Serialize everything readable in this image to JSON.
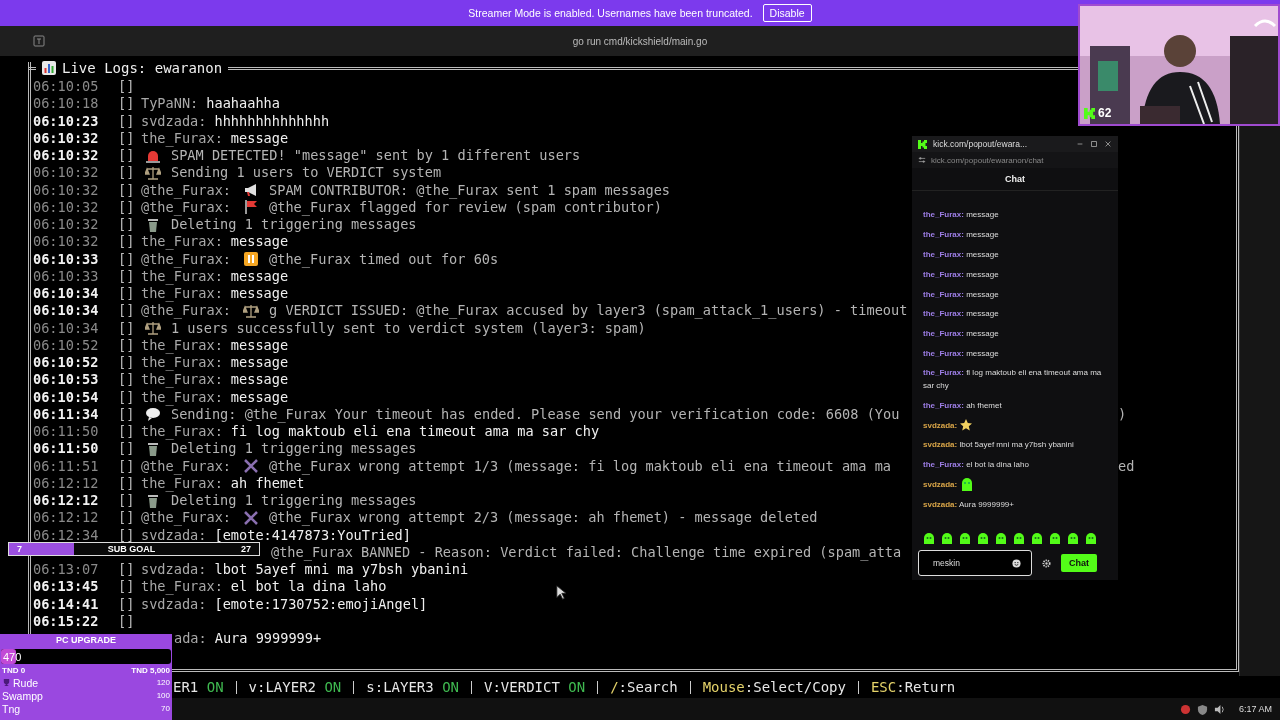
{
  "banner": {
    "text": "Streamer Mode is enabled. Usernames have been truncated.",
    "button": "Disable"
  },
  "terminal": {
    "title": "go run cmd/kickshield/main.go"
  },
  "panel": {
    "title": "Live Logs: ewaranon"
  },
  "logs": [
    {
      "time": "06:10:05",
      "bright": false,
      "tag": "[]",
      "kind": "empty"
    },
    {
      "time": "06:10:18",
      "bright": false,
      "tag": "[]",
      "kind": "chat",
      "user": "TyPaNN:",
      "msg": "haahaahha"
    },
    {
      "time": "06:10:23",
      "bright": true,
      "tag": "[]",
      "kind": "chat",
      "user": "svdzada:",
      "msg": "hhhhhhhhhhhhhh"
    },
    {
      "time": "06:10:32",
      "bright": true,
      "tag": "[]",
      "kind": "chat",
      "user": "the_Furax:",
      "msg": "message"
    },
    {
      "time": "06:10:32",
      "bright": true,
      "tag": "[]",
      "kind": "siren",
      "msg": "SPAM DETECTED! \"message\" sent by 1 different users"
    },
    {
      "time": "06:10:32",
      "bright": false,
      "tag": "[]",
      "kind": "scales",
      "msg": "Sending 1 users to VERDICT system"
    },
    {
      "time": "06:10:32",
      "bright": false,
      "tag": "[]",
      "kind": "megaphone",
      "user": "@the_Furax:",
      "msg": "SPAM CONTRIBUTOR: @the_Furax sent 1 spam messages"
    },
    {
      "time": "06:10:32",
      "bright": false,
      "tag": "[]",
      "kind": "flag",
      "user": "@the_Furax:",
      "msg": "@the_Furax flagged for review (spam contributor)"
    },
    {
      "time": "06:10:32",
      "bright": false,
      "tag": "[]",
      "kind": "trash",
      "msg": "Deleting 1 triggering messages"
    },
    {
      "time": "06:10:32",
      "bright": false,
      "tag": "[]",
      "kind": "chat",
      "user": "the_Furax:",
      "msg": "message"
    },
    {
      "time": "06:10:33",
      "bright": true,
      "tag": "[]",
      "kind": "pause",
      "user": "@the_Furax:",
      "msg": "@the_Furax timed out for 60s"
    },
    {
      "time": "06:10:33",
      "bright": false,
      "tag": "[]",
      "kind": "chat",
      "user": "the_Furax:",
      "msg": "message"
    },
    {
      "time": "06:10:34",
      "bright": true,
      "tag": "[]",
      "kind": "chat",
      "user": "the_Furax:",
      "msg": "message"
    },
    {
      "time": "06:10:34",
      "bright": true,
      "tag": "[]",
      "kind": "scales",
      "user": "@the_Furax:",
      "msg": "g VERDICT ISSUED: @the_Furax accused by layer3 (spam_attack_1_users) - timeout"
    },
    {
      "time": "06:10:34",
      "bright": false,
      "tag": "[]",
      "kind": "scales",
      "msg": "1 users successfully sent to verdict system (layer3: spam)"
    },
    {
      "time": "06:10:52",
      "bright": false,
      "tag": "[]",
      "kind": "chat",
      "user": "the_Furax:",
      "msg": "message"
    },
    {
      "time": "06:10:52",
      "bright": true,
      "tag": "[]",
      "kind": "chat",
      "user": "the_Furax:",
      "msg": "message"
    },
    {
      "time": "06:10:53",
      "bright": true,
      "tag": "[]",
      "kind": "chat",
      "user": "the_Furax:",
      "msg": "message"
    },
    {
      "time": "06:10:54",
      "bright": true,
      "tag": "[]",
      "kind": "chat",
      "user": "the_Furax:",
      "msg": "message"
    },
    {
      "time": "06:11:34",
      "bright": true,
      "tag": "[]",
      "kind": "speech",
      "msg": "Sending: @the_Furax Your timeout has ended. Please send your verification code: 6608 (You",
      "tail": ")"
    },
    {
      "time": "06:11:50",
      "bright": false,
      "tag": "[]",
      "kind": "chat",
      "user": "the_Furax:",
      "msg": "fi log maktoub eli ena timeout ama ma sar chy"
    },
    {
      "time": "06:11:50",
      "bright": true,
      "tag": "[]",
      "kind": "trash",
      "msg": "Deleting 1 triggering messages"
    },
    {
      "time": "06:11:51",
      "bright": false,
      "tag": "[]",
      "kind": "cross",
      "user": "@the_Furax:",
      "msg": "@the_Furax wrong attempt 1/3 (message: fi log maktoub eli ena timeout ama ma",
      "tail": "ed"
    },
    {
      "time": "06:12:12",
      "bright": false,
      "tag": "[]",
      "kind": "chat",
      "user": "the_Furax:",
      "msg": "ah fhemet"
    },
    {
      "time": "06:12:12",
      "bright": true,
      "tag": "[]",
      "kind": "trash",
      "msg": "Deleting 1 triggering messages"
    },
    {
      "time": "06:12:12",
      "bright": false,
      "tag": "[]",
      "kind": "cross",
      "user": "@the_Furax:",
      "msg": "@the_Furax wrong attempt 2/3 (message: ah fhemet) - message deleted"
    },
    {
      "time": "06:12:34",
      "bright": false,
      "tag": "[]",
      "kind": "chat",
      "user": "svdzada:",
      "msg": "[emote:4147873:YouTried]"
    },
    {
      "kind": "covered",
      "msg": "@the_Furax BANNED - Reason: Verdict failed: Challenge time expired (spam_atta"
    },
    {
      "time": "06:13:07",
      "bright": false,
      "tag": "[]",
      "kind": "chat",
      "user": "svdzada:",
      "msg": "lbot 5ayef mni ma y7bsh ybanini"
    },
    {
      "time": "06:13:45",
      "bright": true,
      "tag": "[]",
      "kind": "chat",
      "user": "the_Furax:",
      "msg": "el bot la dina laho"
    },
    {
      "time": "06:14:41",
      "bright": true,
      "tag": "[]",
      "kind": "chat",
      "user": "svdzada:",
      "msg": "[emote:1730752:emojiAngel]"
    },
    {
      "time": "06:15:22",
      "bright": true,
      "tag": "[]",
      "kind": "empty"
    },
    {
      "kind": "covered_chat",
      "user": "ada:",
      "msg": "Aura 9999999+"
    }
  ],
  "status_bar": [
    {
      "kind": "toggle",
      "label": "ER1",
      "flag": "ON",
      "on": true
    },
    {
      "kind": "toggle",
      "label": "v:LAYER2",
      "flag": "ON",
      "on": true
    },
    {
      "kind": "toggle",
      "label": "s:LAYER3",
      "flag": "ON",
      "on": true
    },
    {
      "kind": "toggle",
      "label": "V:VERDICT",
      "flag": "ON",
      "on": true
    },
    {
      "kind": "key",
      "key": "/",
      "action": ":Search"
    },
    {
      "kind": "key",
      "key": "Mouse",
      "action": ":Select/Copy"
    },
    {
      "kind": "key",
      "key": "ESC",
      "action": ":Return"
    }
  ],
  "webcam": {
    "viewers": "62"
  },
  "chat": {
    "window_title": "kick.com/popout/ewara...",
    "url": "kick.com/popout/ewaranon/chat",
    "header": "Chat",
    "messages": [
      {
        "user": "the_Furax:",
        "color": "#9d7ee6",
        "kind": "text",
        "text": "message"
      },
      {
        "user": "the_Furax:",
        "color": "#9d7ee6",
        "kind": "text",
        "text": "message"
      },
      {
        "user": "the_Furax:",
        "color": "#9d7ee6",
        "kind": "text",
        "text": "message"
      },
      {
        "user": "the_Furax:",
        "color": "#9d7ee6",
        "kind": "text",
        "text": "message"
      },
      {
        "user": "the_Furax:",
        "color": "#9d7ee6",
        "kind": "text",
        "text": "message"
      },
      {
        "user": "the_Furax:",
        "color": "#9d7ee6",
        "kind": "text",
        "text": "message"
      },
      {
        "user": "the_Furax:",
        "color": "#9d7ee6",
        "kind": "text",
        "text": "message"
      },
      {
        "user": "the_Furax:",
        "color": "#9d7ee6",
        "kind": "text",
        "text": "message"
      },
      {
        "user": "the_Furax:",
        "color": "#9d7ee6",
        "kind": "text",
        "text": "fi log maktoub eli ena timeout ama ma sar chy"
      },
      {
        "user": "the_Furax:",
        "color": "#9d7ee6",
        "kind": "text",
        "text": "ah fhemet"
      },
      {
        "user": "svdzada:",
        "color": "#d9a548",
        "kind": "star_emote"
      },
      {
        "user": "svdzada:",
        "color": "#d9a548",
        "kind": "text",
        "text": "lbot 5ayef mni ma y7bsh ybanini"
      },
      {
        "user": "the_Furax:",
        "color": "#9d7ee6",
        "kind": "text",
        "text": "el bot la dina laho"
      },
      {
        "user": "svdzada:",
        "color": "#d9a548",
        "kind": "blob_emote"
      },
      {
        "user": "svdzada:",
        "color": "#d9a548",
        "kind": "text",
        "text": "Aura 9999999+"
      }
    ],
    "input": {
      "value": "meskin"
    },
    "send": "Chat"
  },
  "sub_goal": {
    "current": "7",
    "label": "SUB GOAL",
    "target": "27",
    "level": 0.26
  },
  "upgrade": {
    "title": "PC UPGRADE",
    "amount": "470",
    "level": 0.09,
    "min": "TND 0",
    "max": "TND 5,000",
    "leaders": [
      {
        "name": "Rude",
        "score": "120",
        "top": true
      },
      {
        "name": "Swampp",
        "score": "100",
        "top": false
      },
      {
        "name": "Tng",
        "score": "70",
        "top": false
      }
    ]
  },
  "clock": "6:17 AM"
}
